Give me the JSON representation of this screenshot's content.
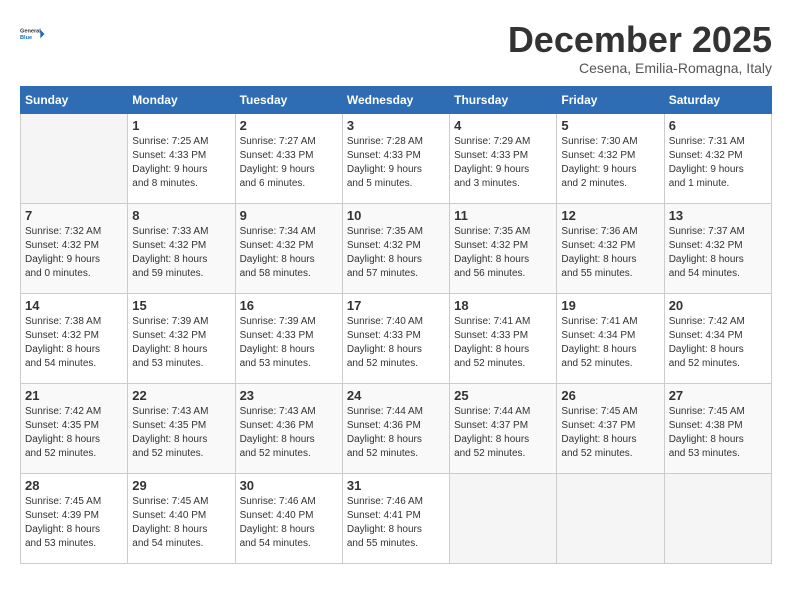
{
  "logo": {
    "line1": "General",
    "line2": "Blue"
  },
  "title": "December 2025",
  "subtitle": "Cesena, Emilia-Romagna, Italy",
  "headers": [
    "Sunday",
    "Monday",
    "Tuesday",
    "Wednesday",
    "Thursday",
    "Friday",
    "Saturday"
  ],
  "weeks": [
    [
      {
        "day": "",
        "info": ""
      },
      {
        "day": "1",
        "info": "Sunrise: 7:25 AM\nSunset: 4:33 PM\nDaylight: 9 hours\nand 8 minutes."
      },
      {
        "day": "2",
        "info": "Sunrise: 7:27 AM\nSunset: 4:33 PM\nDaylight: 9 hours\nand 6 minutes."
      },
      {
        "day": "3",
        "info": "Sunrise: 7:28 AM\nSunset: 4:33 PM\nDaylight: 9 hours\nand 5 minutes."
      },
      {
        "day": "4",
        "info": "Sunrise: 7:29 AM\nSunset: 4:33 PM\nDaylight: 9 hours\nand 3 minutes."
      },
      {
        "day": "5",
        "info": "Sunrise: 7:30 AM\nSunset: 4:32 PM\nDaylight: 9 hours\nand 2 minutes."
      },
      {
        "day": "6",
        "info": "Sunrise: 7:31 AM\nSunset: 4:32 PM\nDaylight: 9 hours\nand 1 minute."
      }
    ],
    [
      {
        "day": "7",
        "info": "Sunrise: 7:32 AM\nSunset: 4:32 PM\nDaylight: 9 hours\nand 0 minutes."
      },
      {
        "day": "8",
        "info": "Sunrise: 7:33 AM\nSunset: 4:32 PM\nDaylight: 8 hours\nand 59 minutes."
      },
      {
        "day": "9",
        "info": "Sunrise: 7:34 AM\nSunset: 4:32 PM\nDaylight: 8 hours\nand 58 minutes."
      },
      {
        "day": "10",
        "info": "Sunrise: 7:35 AM\nSunset: 4:32 PM\nDaylight: 8 hours\nand 57 minutes."
      },
      {
        "day": "11",
        "info": "Sunrise: 7:35 AM\nSunset: 4:32 PM\nDaylight: 8 hours\nand 56 minutes."
      },
      {
        "day": "12",
        "info": "Sunrise: 7:36 AM\nSunset: 4:32 PM\nDaylight: 8 hours\nand 55 minutes."
      },
      {
        "day": "13",
        "info": "Sunrise: 7:37 AM\nSunset: 4:32 PM\nDaylight: 8 hours\nand 54 minutes."
      }
    ],
    [
      {
        "day": "14",
        "info": "Sunrise: 7:38 AM\nSunset: 4:32 PM\nDaylight: 8 hours\nand 54 minutes."
      },
      {
        "day": "15",
        "info": "Sunrise: 7:39 AM\nSunset: 4:32 PM\nDaylight: 8 hours\nand 53 minutes."
      },
      {
        "day": "16",
        "info": "Sunrise: 7:39 AM\nSunset: 4:33 PM\nDaylight: 8 hours\nand 53 minutes."
      },
      {
        "day": "17",
        "info": "Sunrise: 7:40 AM\nSunset: 4:33 PM\nDaylight: 8 hours\nand 52 minutes."
      },
      {
        "day": "18",
        "info": "Sunrise: 7:41 AM\nSunset: 4:33 PM\nDaylight: 8 hours\nand 52 minutes."
      },
      {
        "day": "19",
        "info": "Sunrise: 7:41 AM\nSunset: 4:34 PM\nDaylight: 8 hours\nand 52 minutes."
      },
      {
        "day": "20",
        "info": "Sunrise: 7:42 AM\nSunset: 4:34 PM\nDaylight: 8 hours\nand 52 minutes."
      }
    ],
    [
      {
        "day": "21",
        "info": "Sunrise: 7:42 AM\nSunset: 4:35 PM\nDaylight: 8 hours\nand 52 minutes."
      },
      {
        "day": "22",
        "info": "Sunrise: 7:43 AM\nSunset: 4:35 PM\nDaylight: 8 hours\nand 52 minutes."
      },
      {
        "day": "23",
        "info": "Sunrise: 7:43 AM\nSunset: 4:36 PM\nDaylight: 8 hours\nand 52 minutes."
      },
      {
        "day": "24",
        "info": "Sunrise: 7:44 AM\nSunset: 4:36 PM\nDaylight: 8 hours\nand 52 minutes."
      },
      {
        "day": "25",
        "info": "Sunrise: 7:44 AM\nSunset: 4:37 PM\nDaylight: 8 hours\nand 52 minutes."
      },
      {
        "day": "26",
        "info": "Sunrise: 7:45 AM\nSunset: 4:37 PM\nDaylight: 8 hours\nand 52 minutes."
      },
      {
        "day": "27",
        "info": "Sunrise: 7:45 AM\nSunset: 4:38 PM\nDaylight: 8 hours\nand 53 minutes."
      }
    ],
    [
      {
        "day": "28",
        "info": "Sunrise: 7:45 AM\nSunset: 4:39 PM\nDaylight: 8 hours\nand 53 minutes."
      },
      {
        "day": "29",
        "info": "Sunrise: 7:45 AM\nSunset: 4:40 PM\nDaylight: 8 hours\nand 54 minutes."
      },
      {
        "day": "30",
        "info": "Sunrise: 7:46 AM\nSunset: 4:40 PM\nDaylight: 8 hours\nand 54 minutes."
      },
      {
        "day": "31",
        "info": "Sunrise: 7:46 AM\nSunset: 4:41 PM\nDaylight: 8 hours\nand 55 minutes."
      },
      {
        "day": "",
        "info": ""
      },
      {
        "day": "",
        "info": ""
      },
      {
        "day": "",
        "info": ""
      }
    ]
  ]
}
